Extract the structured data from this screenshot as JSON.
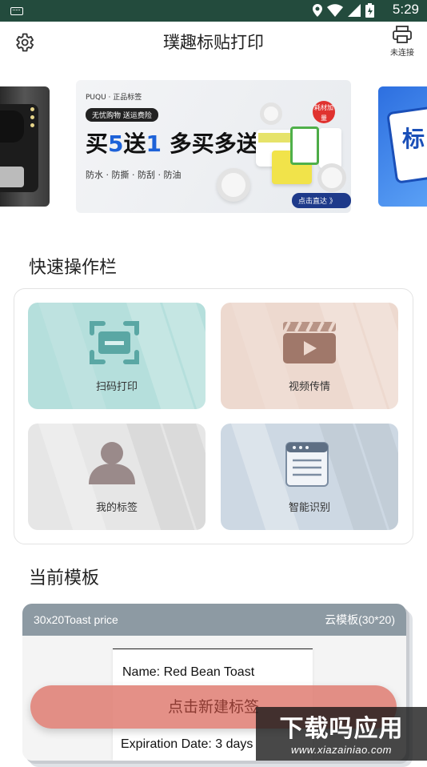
{
  "status_bar": {
    "time": "5:29"
  },
  "header": {
    "title": "璞趣标贴打印",
    "printer_status": "未连接"
  },
  "banner": {
    "brand": "PUQU · 正品标签",
    "tagline": "无忧购物 送运费险",
    "headline_part1": "买",
    "headline_num1": "5",
    "headline_part2": "送",
    "headline_num2": "1",
    "headline_part3": " 多买多送",
    "features": "防水 · 防撕 · 防刮 · 防油",
    "badge": "耗材加量",
    "cta": "点击直达 》",
    "right_peek_text": "标"
  },
  "quick_actions": {
    "title": "快速操作栏",
    "items": [
      {
        "label": "扫码打印",
        "color": "#b5dfdc"
      },
      {
        "label": "视频传情",
        "color": "#edd9cf"
      },
      {
        "label": "我的标签",
        "color": "#e6e6e6"
      },
      {
        "label": "智能识别",
        "color": "#cdd8e3"
      }
    ]
  },
  "current_template": {
    "title": "当前模板",
    "name": "30x20Toast price",
    "type": "云模板(30*20)",
    "lines": [
      "Name: Red Bean Toast",
      "Expiration Date: 3 days"
    ]
  },
  "fab_label": "点击新建标签",
  "watermark": {
    "title": "下载吗应用",
    "url": "www.xiazainiao.com"
  }
}
